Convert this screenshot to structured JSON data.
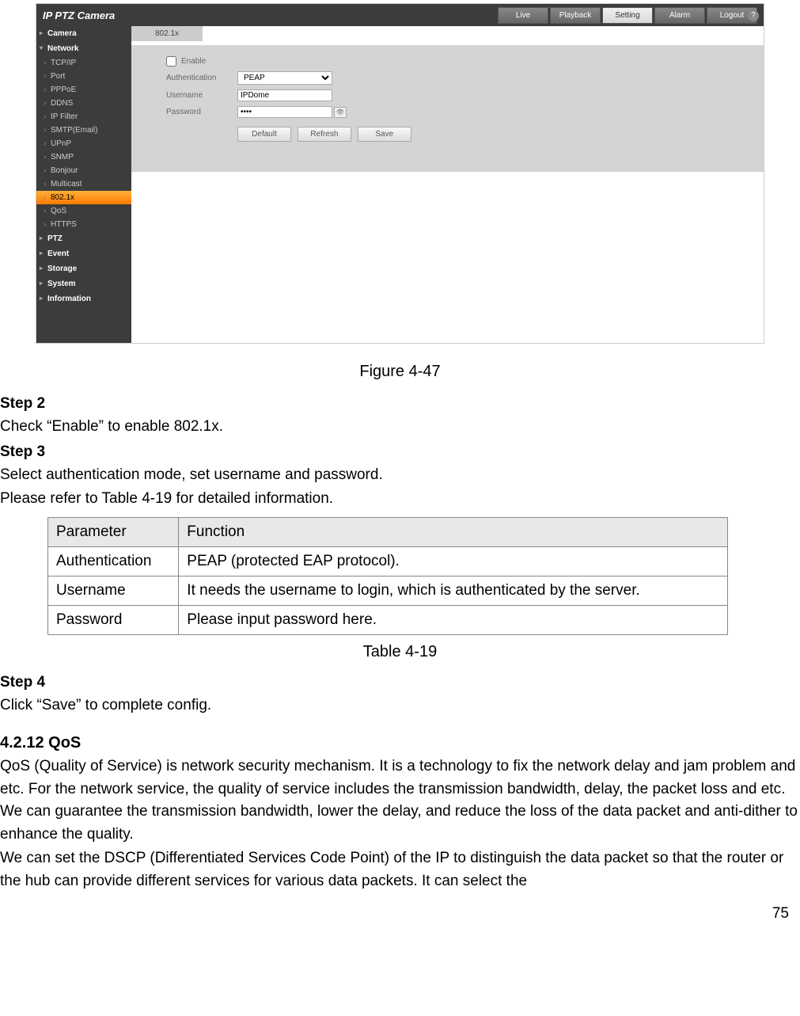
{
  "screenshot": {
    "logo": "IP PTZ Camera",
    "top_tabs": [
      "Live",
      "Playback",
      "Setting",
      "Alarm",
      "Logout"
    ],
    "active_top_tab": "Setting",
    "sidebar": {
      "categories": [
        {
          "label": "Camera",
          "expanded": false
        },
        {
          "label": "Network",
          "expanded": true,
          "subs": [
            "TCP/IP",
            "Port",
            "PPPoE",
            "DDNS",
            "IP Filter",
            "SMTP(Email)",
            "UPnP",
            "SNMP",
            "Bonjour",
            "Multicast",
            "802.1x",
            "QoS",
            "HTTPS"
          ],
          "active_sub": "802.1x"
        },
        {
          "label": "PTZ",
          "expanded": false
        },
        {
          "label": "Event",
          "expanded": false
        },
        {
          "label": "Storage",
          "expanded": false
        },
        {
          "label": "System",
          "expanded": false
        },
        {
          "label": "Information",
          "expanded": false
        }
      ]
    },
    "panel": {
      "tab_label": "802.1x",
      "help_icon": "?",
      "enable_label": "Enable",
      "enable_checked": false,
      "auth_label": "Authentication",
      "auth_value": "PEAP",
      "user_label": "Username",
      "user_value": "IPDome",
      "pass_label": "Password",
      "pass_value": "••••",
      "buttons": {
        "default": "Default",
        "refresh": "Refresh",
        "save": "Save"
      }
    }
  },
  "doc": {
    "figure_caption": "Figure 4-47",
    "step2_hdr": "Step 2",
    "step2_text": "Check “Enable” to enable 802.1x.",
    "step3_hdr": "Step 3",
    "step3_line1": "Select authentication mode, set username and password.",
    "step3_line2": "Please refer to Table 4-19 for detailed information.",
    "table": {
      "headers": [
        "Parameter",
        "Function"
      ],
      "rows": [
        [
          "Authentication",
          "PEAP (protected EAP protocol)."
        ],
        [
          "Username",
          "It needs the username to login, which is authenticated by the server."
        ],
        [
          "Password",
          "Please input password here."
        ]
      ]
    },
    "table_caption": "Table 4-19",
    "step4_hdr": "Step 4",
    "step4_text": "Click “Save” to complete config.",
    "sec_hdr": "4.2.12 QoS",
    "qos_p1": "QoS (Quality of Service) is network security mechanism. It is a technology to fix the network delay and jam problem and etc. For the network service, the quality of service includes the transmission bandwidth, delay, the packet loss and etc. We can guarantee the transmission bandwidth, lower the delay, and reduce the loss of the data packet and anti-dither to enhance the quality.",
    "qos_p2": "We can set the DSCP (Differentiated Services Code Point) of the IP to distinguish the data packet so that the router or the hub can provide different services for various data packets. It can select the",
    "page_number": "75"
  }
}
